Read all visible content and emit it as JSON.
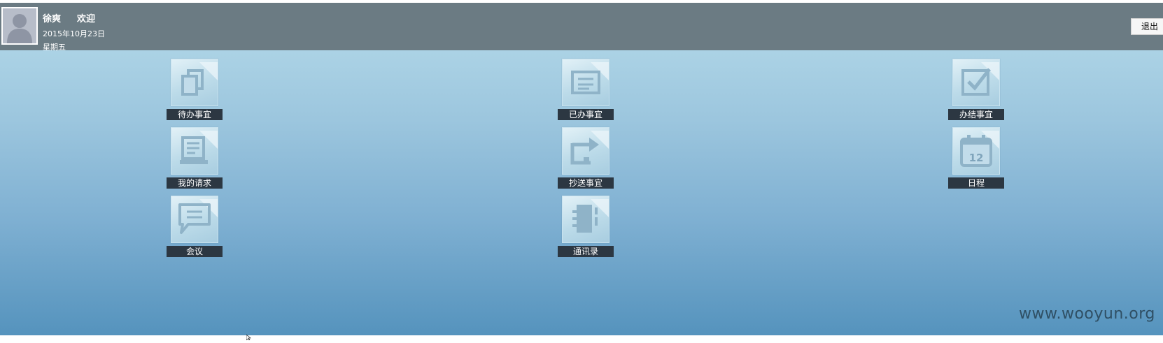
{
  "header": {
    "user_name": "徐爽",
    "welcome": "欢迎",
    "date": "2015年10月23日",
    "weekday": "星期五",
    "logout_label": "退出"
  },
  "tiles": [
    {
      "label": "待办事宜",
      "icon": "pending-items-icon"
    },
    {
      "label": "已办事宜",
      "icon": "done-items-icon"
    },
    {
      "label": "办结事宜",
      "icon": "completed-items-icon"
    },
    {
      "label": "我的请求",
      "icon": "my-requests-icon"
    },
    {
      "label": "抄送事宜",
      "icon": "cc-items-icon"
    },
    {
      "label": "日程",
      "icon": "calendar-icon",
      "calendar_day": "12"
    },
    {
      "label": "会议",
      "icon": "meeting-icon"
    },
    {
      "label": "通讯录",
      "icon": "contacts-icon"
    }
  ],
  "watermark": "www.wooyun.org",
  "colors": {
    "header_bg": "#6b7b83",
    "label_bg": "#2c3742",
    "page_gradient_top": "#b6dbea",
    "page_gradient_bottom": "#5593bd"
  }
}
